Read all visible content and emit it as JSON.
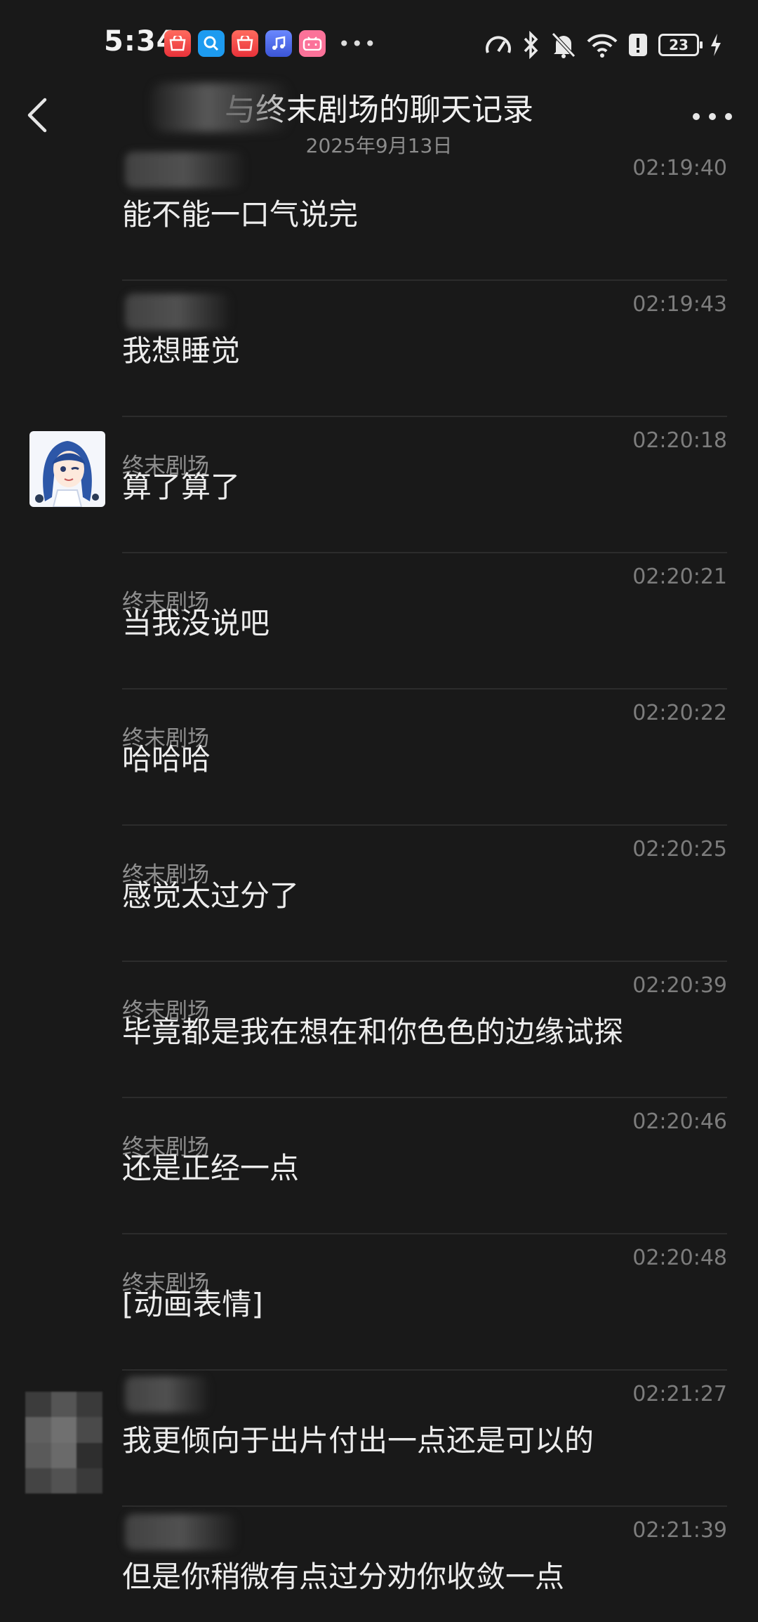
{
  "status_bar": {
    "time": "5:34",
    "battery_level": "23",
    "notification_icons": [
      "huawei-mall-icon",
      "search-app-icon",
      "huawei-mall-icon",
      "music-app-icon",
      "bilibili-icon"
    ],
    "system_icons": [
      "speed-icon",
      "bluetooth-icon",
      "mute-icon",
      "wifi-icon",
      "alert-icon",
      "battery-icon",
      "charging-icon"
    ]
  },
  "header": {
    "title": "与终末剧场的聊天记录",
    "date": "2025年9月13日"
  },
  "messages": [
    {
      "sender": "",
      "time": "02:19:40",
      "text": "能不能一口气说完"
    },
    {
      "sender": "",
      "time": "02:19:43",
      "text": "我想睡觉"
    },
    {
      "sender": "终末剧场",
      "time": "02:20:18",
      "text": "算了算了"
    },
    {
      "sender": "终末剧场",
      "time": "02:20:21",
      "text": "当我没说吧"
    },
    {
      "sender": "终末剧场",
      "time": "02:20:22",
      "text": "哈哈哈"
    },
    {
      "sender": "终末剧场",
      "time": "02:20:25",
      "text": "感觉太过分了"
    },
    {
      "sender": "终末剧场",
      "time": "02:20:39",
      "text": "毕竟都是我在想在和你色色的边缘试探"
    },
    {
      "sender": "终末剧场",
      "time": "02:20:46",
      "text": "还是正经一点"
    },
    {
      "sender": "终末剧场",
      "time": "02:20:48",
      "text": "[动画表情]"
    },
    {
      "sender": "",
      "time": "02:21:27",
      "text": "我更倾向于出片付出一点还是可以的"
    },
    {
      "sender": "",
      "time": "02:21:39",
      "text": "但是你稍微有点过分劝你收敛一点"
    }
  ],
  "colors": {
    "background": "#191919",
    "text_primary": "#ececec",
    "text_secondary": "#8e8e8e",
    "divider": "#2c2c2c"
  }
}
